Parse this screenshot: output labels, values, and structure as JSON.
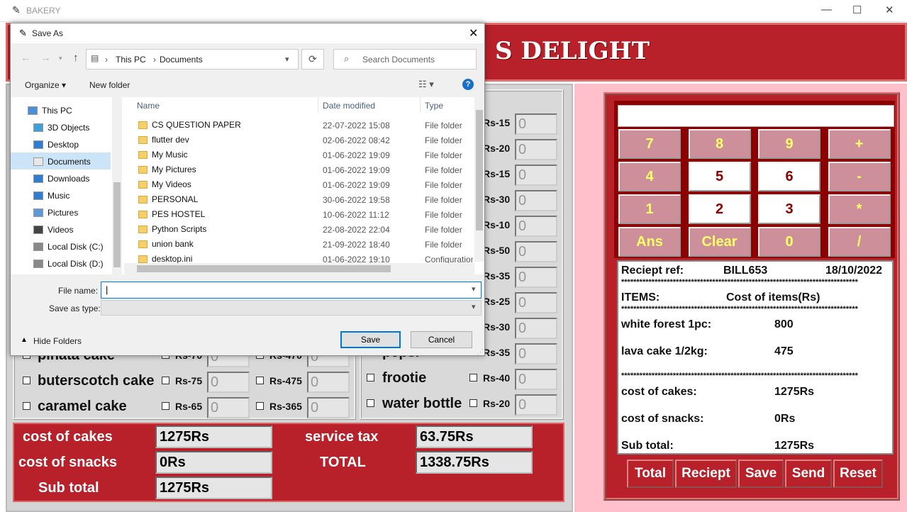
{
  "window": {
    "title": "BAKERY",
    "min": "—",
    "max": "☐",
    "close": "✕"
  },
  "banner": {
    "title": "S DELIGHT"
  },
  "cakes": [
    {
      "name": "pinata cake",
      "p1": "Rs-70",
      "q1": "0",
      "p2": "Rs-470",
      "q2": "0"
    },
    {
      "name": "buterscotch cake",
      "p1": "Rs-75",
      "q1": "0",
      "p2": "Rs-475",
      "q2": "0"
    },
    {
      "name": "caramel cake",
      "p1": "Rs-65",
      "q1": "0",
      "p2": "Rs-365",
      "q2": "0"
    }
  ],
  "snack_prices": [
    {
      "price": "Rs-15",
      "qty": "0"
    },
    {
      "price": "Rs-20",
      "qty": "0"
    },
    {
      "price": "Rs-15",
      "qty": "0"
    },
    {
      "price": "Rs-30",
      "qty": "0"
    },
    {
      "price": "Rs-10",
      "qty": "0"
    },
    {
      "price": "Rs-50",
      "qty": "0"
    },
    {
      "price": "Rs-35",
      "qty": "0"
    },
    {
      "price": "Rs-25",
      "qty": "0"
    },
    {
      "price": "Rs-30",
      "qty": "0"
    },
    {
      "name": "pepsi",
      "price": "Rs-35",
      "qty": "0"
    },
    {
      "name": "frootie",
      "price": "Rs-40",
      "qty": "0"
    },
    {
      "name": "water bottle",
      "price": "Rs-20",
      "qty": "0"
    }
  ],
  "totals": {
    "cost_cakes_label": "cost of cakes",
    "cost_cakes": "1275Rs",
    "cost_snacks_label": "cost of snacks",
    "cost_snacks": "0Rs",
    "subtotal_label": "Sub total",
    "subtotal": "1275Rs",
    "tax_label": "service tax",
    "tax": "63.75Rs",
    "total_label": "TOTAL",
    "total": "1338.75Rs"
  },
  "calc": {
    "display": "",
    "keys": [
      "7",
      "8",
      "9",
      "+",
      "4",
      "5",
      "6",
      "-",
      "1",
      "2",
      "3",
      "*",
      "Ans",
      "Clear",
      "0",
      "/"
    ]
  },
  "receipt": {
    "ref_label": "Reciept ref:",
    "ref": "BILL653",
    "date": "18/10/2022",
    "stars": "******************************************************************************",
    "items_label": "ITEMS:",
    "cost_label": "Cost of items(Rs)",
    "items": [
      {
        "name": "white forest 1pc:",
        "cost": "800"
      },
      {
        "name": "lava cake 1/2kg:",
        "cost": "475"
      }
    ],
    "cakes_label": "cost of cakes:",
    "cakes": "1275Rs",
    "snacks_label": "cost of snacks:",
    "snacks": "0Rs",
    "sub_label": "Sub total:",
    "sub": "1275Rs"
  },
  "actions": {
    "total": "Total",
    "receipt": "Reciept",
    "save": "Save",
    "send": "Send",
    "reset": "Reset"
  },
  "dialog": {
    "title": "Save As",
    "path": [
      "This PC",
      "Documents"
    ],
    "search_placeholder": "Search Documents",
    "organize": "Organize ▾",
    "new_folder": "New folder",
    "nav": [
      "This PC",
      "3D Objects",
      "Desktop",
      "Documents",
      "Downloads",
      "Music",
      "Pictures",
      "Videos",
      "Local Disk (C:)",
      "Local Disk (D:)"
    ],
    "columns": {
      "name": "Name",
      "date": "Date modified",
      "type": "Type"
    },
    "files": [
      {
        "name": "CS QUESTION PAPER",
        "date": "22-07-2022 15:08",
        "type": "File folder"
      },
      {
        "name": "flutter dev",
        "date": "02-06-2022 08:42",
        "type": "File folder"
      },
      {
        "name": "My Music",
        "date": "01-06-2022 19:09",
        "type": "File folder"
      },
      {
        "name": "My Pictures",
        "date": "01-06-2022 19:09",
        "type": "File folder"
      },
      {
        "name": "My Videos",
        "date": "01-06-2022 19:09",
        "type": "File folder"
      },
      {
        "name": "PERSONAL",
        "date": "30-06-2022 19:58",
        "type": "File folder"
      },
      {
        "name": "PES HOSTEL",
        "date": "10-06-2022 11:12",
        "type": "File folder"
      },
      {
        "name": "Python Scripts",
        "date": "22-08-2022 22:04",
        "type": "File folder"
      },
      {
        "name": "union bank",
        "date": "21-09-2022 18:40",
        "type": "File folder"
      },
      {
        "name": "desktop.ini",
        "date": "01-06-2022 19:10",
        "type": "Configuration"
      }
    ],
    "file_name_label": "File name:",
    "file_name": "",
    "save_type_label": "Save as type:",
    "save_type": "",
    "hide_folders": "Hide Folders",
    "save": "Save",
    "cancel": "Cancel"
  },
  "colors": {
    "brand": "#b8202a",
    "pink": "#ffc0cb",
    "key_pink": "#cd8f9a",
    "key_text": "#ffff66"
  }
}
